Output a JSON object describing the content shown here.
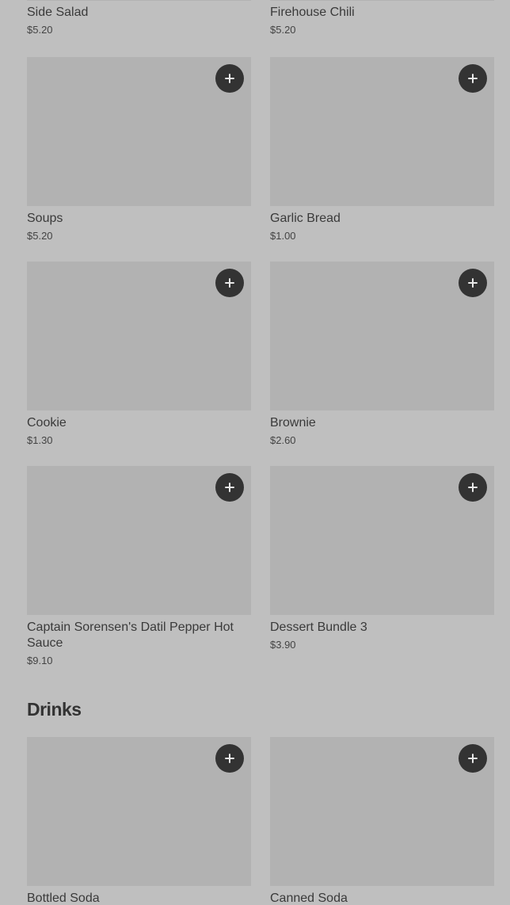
{
  "top_items": [
    {
      "name": "Side Salad",
      "price": "$5.20"
    },
    {
      "name": "Firehouse Chili",
      "price": "$5.20"
    }
  ],
  "items": [
    {
      "name": "Soups",
      "price": "$5.20"
    },
    {
      "name": "Garlic Bread",
      "price": "$1.00"
    },
    {
      "name": "Cookie",
      "price": "$1.30"
    },
    {
      "name": "Brownie",
      "price": "$2.60"
    },
    {
      "name": "Captain Sorensen's Datil Pepper Hot Sauce",
      "price": "$9.10"
    },
    {
      "name": "Dessert Bundle 3",
      "price": "$3.90"
    }
  ],
  "drinks_section": {
    "title": "Drinks",
    "items": [
      {
        "name": "Bottled Soda"
      },
      {
        "name": "Canned Soda"
      }
    ]
  },
  "icons": {
    "add": "plus-icon"
  },
  "colors": {
    "background": "#bfbfbf",
    "image_placeholder": "#b2b2b2",
    "add_button": "#333333"
  }
}
